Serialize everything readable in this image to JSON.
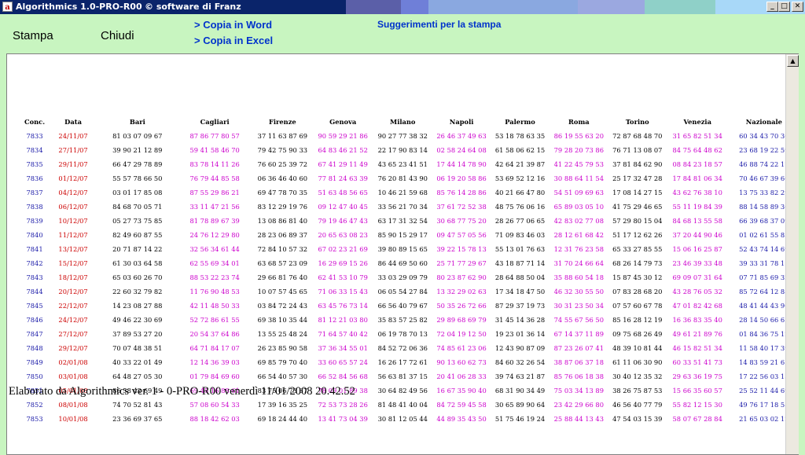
{
  "window": {
    "title": "Algorithmics 1.0-PRO-R00",
    "copyright": "© software di Franz",
    "buttons": {
      "minimize": "_",
      "maximize": "□",
      "close": "✕"
    }
  },
  "toolbar": {
    "stampa": "Stampa",
    "chiudi": "Chiudi",
    "copia_word": "> Copia in Word",
    "copia_excel": "> Copia in Excel",
    "suggerimenti": "Suggerimenti per la stampa"
  },
  "table": {
    "headers": [
      "Conc.",
      "Data",
      "Bari",
      "Cagliari",
      "Firenze",
      "Genova",
      "Milano",
      "Napoli",
      "Palermo",
      "Roma",
      "Torino",
      "Venezia",
      "Nazionale"
    ],
    "rows": [
      [
        "7833",
        "24/11/07",
        "81 03 07 09 67",
        "87 86 77 80 57",
        "37 11 63 87 69",
        "90 59 29 21 86",
        "90 27 77 38 32",
        "26 46 37 49 63",
        "53 18 78 63 35",
        "86 19 55 63 20",
        "72 87 68 48 70",
        "31 65 82 51 34",
        "60 34 43 70 30"
      ],
      [
        "7834",
        "27/11/07",
        "39 90 21 12 89",
        "59 41 58 46 70",
        "79 42 75 90 33",
        "64 83 46 21 52",
        "22 17 90 83 14",
        "02 58 24 64 08",
        "61 58 06 62 15",
        "79 28 20 73 86",
        "76 71 13 08 07",
        "84 75 64 48 62",
        "23 68 19 22 59"
      ],
      [
        "7835",
        "29/11/07",
        "66 47 29 78 89",
        "83 78 14 11 26",
        "76 60 25 39 72",
        "67 41 29 11 49",
        "43 65 23 41 51",
        "17 44 14 78 90",
        "42 64 21 39 87",
        "41 22 45 79 53",
        "37 81 84 62 90",
        "08 84 23 18 57",
        "46 88 74 22 17"
      ],
      [
        "7836",
        "01/12/07",
        "55 57 78 66 50",
        "76 79 44 85 58",
        "06 36 46 40 60",
        "77 81 24 63 39",
        "76 20 81 43 90",
        "06 19 20 58 86",
        "53 69 52 12 16",
        "30 88 64 11 54",
        "25 17 32 47 28",
        "17 84 81 06 34",
        "70 46 67 39 66"
      ],
      [
        "7837",
        "04/12/07",
        "03 01 17 85 08",
        "87 55 29 86 21",
        "69 47 78 70 35",
        "51 63 48 56 65",
        "10 46 21 59 68",
        "85 76 14 28 86",
        "40 21 66 47 80",
        "54 51 09 69 63",
        "17 08 14 27 15",
        "43 62 76 38 10",
        "13 75 33 82 29"
      ],
      [
        "7838",
        "06/12/07",
        "84 68 70 05 71",
        "33 11 47 21 56",
        "83 12 29 19 76",
        "09 12 47 40 45",
        "33 56 21 70 34",
        "37 61 72 52 38",
        "48 75 76 06 16",
        "65 89 03 05 10",
        "41 75 29 46 65",
        "55 11 19 84 39",
        "88 14 58 89 36"
      ],
      [
        "7839",
        "10/12/07",
        "05 27 73 75 85",
        "81 78 89 67 39",
        "13 08 86 81 40",
        "79 19 46 47 43",
        "63 17 31 32 54",
        "30 68 77 75 20",
        "28 26 77 06 65",
        "42 83 02 77 08",
        "57 29 80 15 04",
        "84 68 13 55 58",
        "66 39 68 37 09"
      ],
      [
        "7840",
        "11/12/07",
        "82 49 60 87 55",
        "24 76 12 29 80",
        "28 23 06 89 37",
        "20 65 63 08 23",
        "85 90 15 29 17",
        "09 47 57 05 56",
        "71 09 83 46 03",
        "28 12 61 68 42",
        "51 17 12 62 26",
        "37 20 44 90 46",
        "01 02 61 55 83"
      ],
      [
        "7841",
        "13/12/07",
        "20 71 87 14 22",
        "32 56 34 61 44",
        "72 84 10 57 32",
        "67 02 23 21 69",
        "39 80 89 15 65",
        "39 22 15 78 13",
        "55 13 01 76 63",
        "12 31 76 23 58",
        "65 33 27 85 55",
        "15 06 16 25 87",
        "52 43 74 14 69"
      ],
      [
        "7842",
        "15/12/07",
        "61 30 03 64 58",
        "62 55 69 34 01",
        "63 68 57 23 09",
        "16 29 69 15 26",
        "86 44 69 50 60",
        "25 71 77 29 67",
        "43 18 87 71 14",
        "31 70 24 66 64",
        "68 26 14 79 73",
        "23 46 39 33 48",
        "39 33 31 78 11"
      ],
      [
        "7843",
        "18/12/07",
        "65 03 60 26 70",
        "88 53 22 23 74",
        "29 66 81 76 40",
        "62 41 53 10 79",
        "33 03 29 09 79",
        "80 23 87 62 90",
        "28 64 88 50 04",
        "35 88 60 54 18",
        "15 87 45 30 12",
        "69 09 07 31 64",
        "07 71 85 69 32"
      ],
      [
        "7844",
        "20/12/07",
        "22 60 32 79 82",
        "11 76 90 48 53",
        "10 07 57 45 65",
        "71 06 33 15 43",
        "06 05 54 27 84",
        "13 32 29 02 63",
        "17 34 18 47 50",
        "46 32 30 55 50",
        "07 83 28 68 20",
        "43 28 76 05 32",
        "85 72 64 12 88"
      ],
      [
        "7845",
        "22/12/07",
        "14 23 08 27 88",
        "42 11 48 50 33",
        "03 84 72 24 43",
        "63 45 76 73 14",
        "66 56 40 79 67",
        "50 35 26 72 66",
        "87 29 37 19 73",
        "30 31 23 50 34",
        "07 57 60 67 78",
        "47 01 82 42 68",
        "48 41 44 43 90"
      ],
      [
        "7846",
        "24/12/07",
        "49 46 22 30 69",
        "52 72 86 61 55",
        "69 38 10 35 44",
        "81 12 21 03 80",
        "35 83 57 25 82",
        "29 89 68 69 79",
        "31 45 14 36 28",
        "74 55 67 56 50",
        "85 16 28 12 19",
        "16 36 83 35 40",
        "28 14 50 66 65"
      ],
      [
        "7847",
        "27/12/07",
        "37 89 53 27 20",
        "20 54 37 64 86",
        "13 55 25 48 24",
        "71 64 57 40 42",
        "06 19 78 70 13",
        "72 04 19 12 50",
        "19 23 01 36 14",
        "67 14 37 11 89",
        "09 75 68 26 49",
        "49 61 21 89 76",
        "01 84 36 75 12"
      ],
      [
        "7848",
        "29/12/07",
        "70 07 48 38 51",
        "64 71 84 17 07",
        "26 23 85 90 58",
        "37 36 34 55 01",
        "84 52 72 06 36",
        "74 85 61 23 06",
        "12 43 90 87 09",
        "87 23 26 07 41",
        "48 39 10 81 44",
        "46 15 82 51 34",
        "11 58 40 17 39"
      ],
      [
        "7849",
        "02/01/08",
        "40 33 22 01 49",
        "12 14 36 39 03",
        "69 85 79 70 40",
        "33 60 65 57 24",
        "16 26 17 72 61",
        "90 13 60 62 73",
        "84 60 32 26 54",
        "38 87 06 37 18",
        "61 11 06 30 90",
        "60 33 51 41 73",
        "14 83 59 21 65"
      ],
      [
        "7850",
        "03/01/08",
        "64 48 27 05 30",
        "01 79 84 69 60",
        "66 54 40 57 30",
        "66 52 84 56 68",
        "56 63 81 37 15",
        "20 41 06 28 33",
        "39 74 63 21 87",
        "85 76 06 18 38",
        "30 40 12 35 32",
        "29 63 36 19 75",
        "17 22 56 03 13"
      ],
      [
        "7851",
        "05/01/08",
        "86 58 42 69 49",
        "69 45 16 88 61",
        "83 75 06 73 67",
        "78 09 01 89 38",
        "30 64 82 49 56",
        "16 67 35 90 40",
        "68 31 90 34 49",
        "75 03 34 13 89",
        "38 26 75 87 53",
        "15 66 35 60 57",
        "25 52 11 44 69"
      ],
      [
        "7852",
        "08/01/08",
        "74 70 52 81 43",
        "57 08 60 54 33",
        "17 39 16 35 25",
        "72 53 73 28 26",
        "81 48 41 40 04",
        "84 72 59 45 58",
        "30 65 89 90 64",
        "23 42 29 66 80",
        "46 56 40 77 79",
        "55 82 12 15 30",
        "49 76 17 18 58"
      ],
      [
        "7853",
        "10/01/08",
        "23 36 69 37 65",
        "88 18 42 62 03",
        "69 18 24 44 40",
        "13 41 73 04 39",
        "30 81 12 05 44",
        "44 89 35 43 50",
        "51 75 46 19 24",
        "25 88 44 13 43",
        "47 54 03 15 39",
        "58 07 67 28 84",
        "21 65 03 02 12"
      ]
    ]
  },
  "footer": "Elaborato da Algorithmics ver. 1 - 0-PRO-R00 venerdì 11/01/2008 20.42.52",
  "colors": {
    "background": "#c8f5c0",
    "conc": "#1a1aa8",
    "date": "#cc0000",
    "magenta": "#cc00cc",
    "link": "#0033cc"
  }
}
